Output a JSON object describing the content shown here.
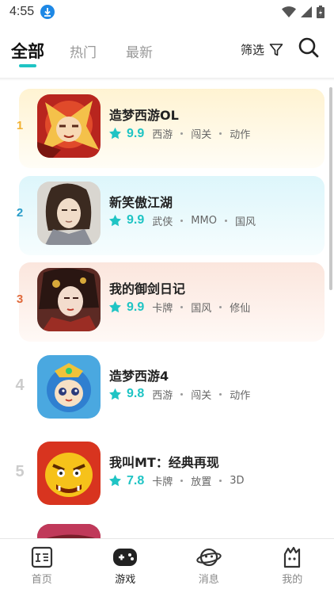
{
  "status": {
    "time": "4:55"
  },
  "tabs": [
    {
      "label": "全部",
      "active": true
    },
    {
      "label": "热门",
      "active": false
    },
    {
      "label": "最新",
      "active": false
    }
  ],
  "header": {
    "filter_label": "筛选"
  },
  "games": [
    {
      "rank": "1",
      "title": "造梦西游OL",
      "score": "9.9",
      "tags": [
        "西游",
        "闯关",
        "动作"
      ],
      "card_color": "#fff7e0",
      "rank_color": "#f2b233"
    },
    {
      "rank": "2",
      "title": "新笑傲江湖",
      "score": "9.9",
      "tags": [
        "武侠",
        "MMO",
        "国风"
      ],
      "card_color": "#e5f8fc",
      "rank_color": "#2a9dc9"
    },
    {
      "rank": "3",
      "title": "我的御剑日记",
      "score": "9.9",
      "tags": [
        "卡牌",
        "国风",
        "修仙"
      ],
      "card_color": "#fdeee8",
      "rank_color": "#e06a3c"
    },
    {
      "rank": "4",
      "title": "造梦西游4",
      "score": "9.8",
      "tags": [
        "西游",
        "闯关",
        "动作"
      ],
      "card_color": "#ffffff",
      "rank_color": "#cccccc"
    },
    {
      "rank": "5",
      "title": "我叫MT：经典再现",
      "score": "7.8",
      "tags": [
        "卡牌",
        "放置",
        "3D"
      ],
      "card_color": "#ffffff",
      "rank_color": "#cccccc"
    }
  ],
  "bottom_nav": [
    {
      "label": "首页",
      "active": false,
      "icon": "home-box-icon"
    },
    {
      "label": "游戏",
      "active": true,
      "icon": "gamepad-icon"
    },
    {
      "label": "消息",
      "active": false,
      "icon": "planet-icon"
    },
    {
      "label": "我的",
      "active": false,
      "icon": "profile-icon"
    }
  ],
  "colors": {
    "accent": "#1fc4c4",
    "nav_active": "#222222"
  }
}
